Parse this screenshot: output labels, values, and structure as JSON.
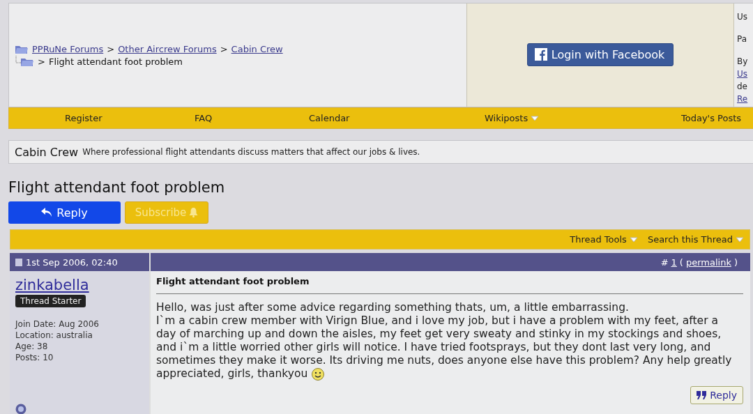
{
  "breadcrumb": {
    "links": [
      "PPRuNe Forums",
      "Other Aircrew Forums",
      "Cabin Crew"
    ],
    "separator": ">",
    "current": "Flight attendant foot problem"
  },
  "facebook_login": {
    "label": "Login with Facebook"
  },
  "login_panel": {
    "lines": [
      {
        "text": "Us",
        "link": false
      },
      {
        "text": "Pa",
        "link": false
      },
      {
        "text": "By",
        "link": false
      },
      {
        "text": "Us",
        "link": true
      },
      {
        "text": "de",
        "link": false
      },
      {
        "text": "Re",
        "link": true
      }
    ]
  },
  "nav": [
    {
      "label": "Register",
      "menu": false
    },
    {
      "label": "FAQ",
      "menu": false
    },
    {
      "label": "Calendar",
      "menu": false
    },
    {
      "label": "Wikiposts",
      "menu": true
    },
    {
      "label": "Today's Posts",
      "menu": false
    }
  ],
  "forum": {
    "name": "Cabin Crew",
    "description": "Where professional flight attendants discuss matters that affect our jobs & lives."
  },
  "thread_title": "Flight attendant foot problem",
  "actions": {
    "reply": "Reply",
    "subscribe": "Subscribe"
  },
  "thread_tools": [
    "Thread Tools",
    "Search this Thread"
  ],
  "post": {
    "date": "1st Sep 2006, 02:40",
    "number_prefix": "#",
    "number": "1",
    "paren_open": "(",
    "permalink": "permalink",
    "paren_close": ")",
    "author": "zinkabella",
    "badge": "Thread Starter",
    "info": [
      "Join Date: Aug 2006",
      "Location: australia",
      "Age: 38",
      "Posts: 10"
    ],
    "title": "Flight attendant foot problem",
    "lines": [
      "Hello, was just after some advice regarding something thats, um, a little embarrassing.",
      "I`m a cabin crew member with Virign Blue, and i love my job, but i have a problem with my feet, after a",
      "day of marching up and down the aisles, my feet get very sweaty and stinky in my stockings and shoes,",
      "and i`m a little worried other girls will notice. I have tried footsprays, but they dont last very long, and",
      "sometimes they make it worse. Its driving me nuts, does anyone else have this problem? Any help greatly",
      "appreciated, girls, thankyou"
    ],
    "quote_reply": "Reply"
  }
}
